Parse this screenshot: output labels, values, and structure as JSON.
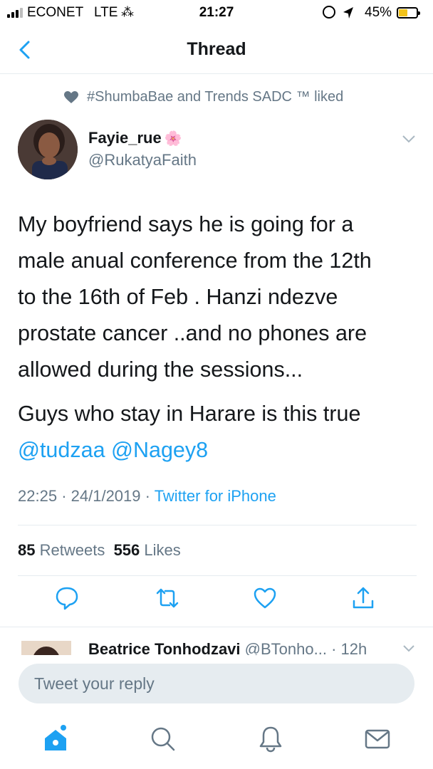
{
  "status_bar": {
    "carrier": "ECONET",
    "network": "LTE",
    "time": "21:27",
    "battery": "45%",
    "battery_color": "#f2c31b"
  },
  "nav": {
    "title": "Thread",
    "back_icon": "chevron-left-icon"
  },
  "social_context": {
    "text": "#ShumbaBae and Trends SADC ™ liked",
    "icon": "heart-icon"
  },
  "tweet": {
    "name": "Fayie_rue",
    "name_emoji": "🌸",
    "handle": "@RukatyaFaith",
    "text_lines": [
      "My boyfriend says he is going for a",
      "male anual conference from the 12th",
      "to the 16th of Feb . Hanzi ndezve",
      "prostate cancer ..and no phones are",
      "allowed during the sessions..."
    ],
    "text_line2": "Guys who stay in Harare is this true",
    "mentions": "@tudzaa @Nagey8",
    "time": "22:25",
    "date": "24/1/2019",
    "source": "Twitter for iPhone",
    "retweets_count": "85",
    "retweets_label": "Retweets",
    "likes_count": "556",
    "likes_label": "Likes"
  },
  "actions": [
    "reply-icon",
    "retweet-icon",
    "like-icon",
    "share-icon"
  ],
  "reply_preview": {
    "name": "Beatrice Tonhodzavi",
    "handle": "@BTonho...",
    "time": "· 12h"
  },
  "reply_bar": {
    "placeholder": "Tweet your reply"
  },
  "tabs": [
    "home-icon",
    "search-icon",
    "notifications-icon",
    "messages-icon"
  ],
  "colors": {
    "accent": "#1da1f2",
    "secondary_text": "#657786"
  }
}
